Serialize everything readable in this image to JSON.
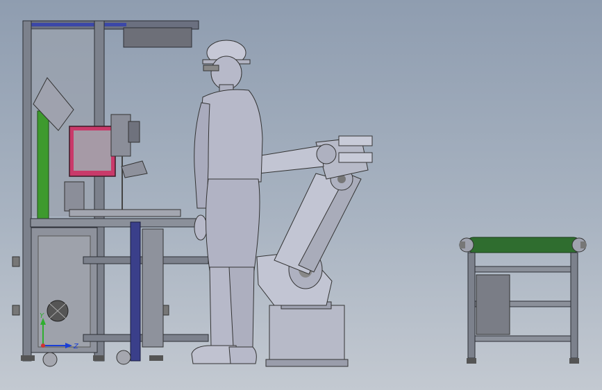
{
  "scene": {
    "triad": {
      "x_label": "Z",
      "y_label": "Y",
      "x_color": "#1a3fd6",
      "y_color": "#2fae2f"
    },
    "colors": {
      "frame": "#5a5f6a",
      "frame_light": "#8b909a",
      "body": "#b7b9c9",
      "body_shade": "#8d90a5",
      "monitor": "#c93a6a",
      "green_tube": "#3e9a2e",
      "conveyor_belt": "#2f6d2f",
      "robot": "#c2c5d3"
    }
  }
}
